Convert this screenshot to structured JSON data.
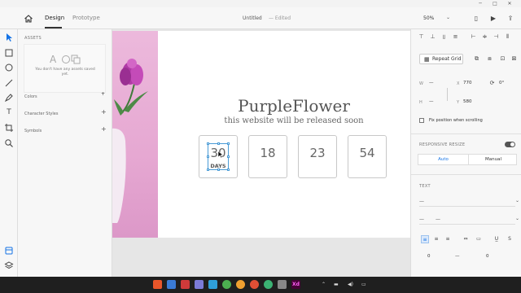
{
  "window": {
    "minimize": "─",
    "maximize": "□",
    "close": "✕"
  },
  "toolbar": {
    "tabs": [
      {
        "label": "Design",
        "active": true
      },
      {
        "label": "Prototype",
        "active": false
      }
    ],
    "doc_title": "Untitled",
    "doc_status": "— Edited",
    "zoom": "50%",
    "zoom_caret": "⌄",
    "icons": [
      "home-icon",
      "mobile-preview-icon",
      "play-icon",
      "share-icon"
    ],
    "mobile_icon": "▯",
    "play_icon": "▶",
    "share_icon": "⇪"
  },
  "tools": [
    "select-tool-icon",
    "rectangle-tool-icon",
    "ellipse-tool-icon",
    "line-tool-icon",
    "pen-tool-icon",
    "text-tool-icon",
    "artboard-tool-icon",
    "zoom-tool-icon",
    "assets-icon",
    "layers-icon"
  ],
  "tool_text_glyph": "T",
  "assets": {
    "header": "ASSETS",
    "empty_message": "You don't have any assets saved yet.",
    "rows": [
      {
        "label": "Colors"
      },
      {
        "label": "Character Styles"
      },
      {
        "label": "Symbols"
      }
    ],
    "plus": "+"
  },
  "canvas": {
    "brand": "PurpleFlower",
    "tagline": "this website will be released soon",
    "countdown": [
      {
        "value": "30",
        "unit": "DAYS",
        "selected": true
      },
      {
        "value": "18",
        "unit": "",
        "selected": false
      },
      {
        "value": "23",
        "unit": "",
        "selected": false
      },
      {
        "value": "54",
        "unit": "",
        "selected": false
      }
    ],
    "colors": {
      "photo_bg": "#e6a8d2",
      "flower": "#b03aa6",
      "vase": "#f4f0f4",
      "selection": "#4a9bd6"
    }
  },
  "inspector": {
    "repeat_grid": "Repeat Grid",
    "repeat_icon": "▦",
    "w_label": "W",
    "w_value": "—",
    "x_label": "X",
    "x_value": "770",
    "h_label": "H",
    "h_value": "—",
    "y_label": "Y",
    "y_value": "580",
    "rotate_icon": "⟳",
    "rotation": "0°",
    "fix_position": "Fix position when scrolling",
    "responsive_resize": "RESPONSIVE RESIZE",
    "resize_options": [
      {
        "label": "Auto",
        "active": true
      },
      {
        "label": "Manual",
        "active": false
      }
    ],
    "text_section": "TEXT",
    "font_family_value": "—",
    "font_size_value": "—",
    "font_weight_value": "—",
    "caret": "⌄",
    "char_spacing": "0",
    "line_spacing": "—",
    "para_spacing": "0",
    "accent_color": "#1473e6"
  },
  "taskbar": {
    "apps": [
      {
        "name": "taskbar-app-1",
        "color": "#e8562a"
      },
      {
        "name": "taskbar-app-2",
        "color": "#3a7bd5"
      },
      {
        "name": "taskbar-app-3",
        "color": "#cf3a3a"
      },
      {
        "name": "taskbar-app-4",
        "color": "#7b7bd8"
      },
      {
        "name": "taskbar-app-5",
        "color": "#2f9fd8"
      },
      {
        "name": "taskbar-app-6",
        "color": "#4caf50"
      },
      {
        "name": "taskbar-app-7",
        "color": "#f0a030"
      },
      {
        "name": "taskbar-app-8",
        "color": "#e04f35"
      },
      {
        "name": "taskbar-app-9",
        "color": "#3bb273"
      },
      {
        "name": "taskbar-app-10",
        "color": "#888888"
      },
      {
        "name": "taskbar-app-xd",
        "color": "#470137",
        "label": "Xd"
      }
    ],
    "tray": [
      "⌃",
      "▬",
      "◀)",
      "▭"
    ]
  }
}
